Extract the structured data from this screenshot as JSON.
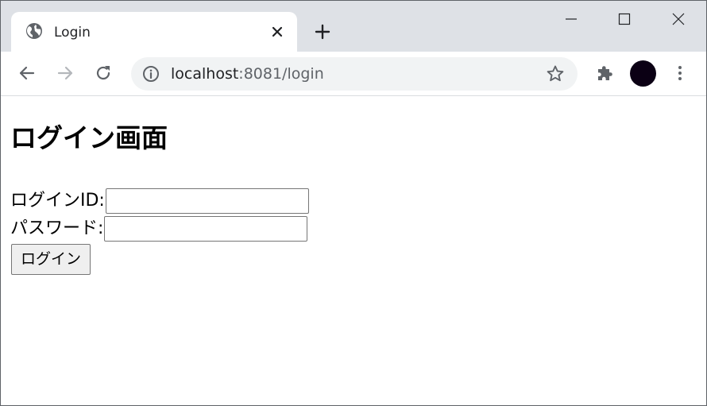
{
  "browser": {
    "tab": {
      "title": "Login",
      "favicon": "globe-icon",
      "close_icon": "close-icon"
    },
    "new_tab_icon": "plus-icon",
    "window_controls": [
      "minimize-icon",
      "maximize-icon",
      "close-icon"
    ],
    "toolbar": {
      "back_icon": "arrow-left-icon",
      "forward_icon": "arrow-right-icon",
      "reload_icon": "reload-icon",
      "extensions_icon": "puzzle-icon",
      "menu_icon": "kebab-menu-icon"
    },
    "omnibox": {
      "info_icon": "info-icon",
      "host": "localhost",
      "path": ":8081/login",
      "bookmark_icon": "star-icon"
    },
    "colors": {
      "tabstrip": "#dee1e6",
      "omnibox": "#f1f3f4",
      "avatar": "#0b0014"
    }
  },
  "page": {
    "title": "ログイン画面",
    "login_id_label": "ログインID:",
    "login_id_value": "",
    "password_label": "パスワード:",
    "password_value": "",
    "submit_label": "ログイン"
  }
}
